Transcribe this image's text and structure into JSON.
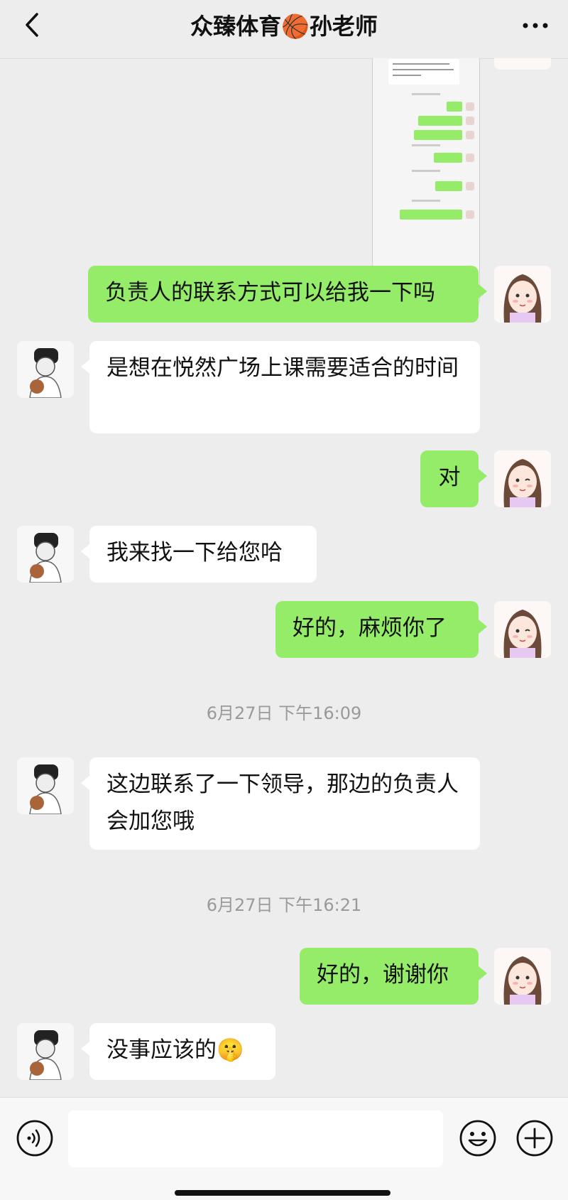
{
  "header": {
    "title": "众臻体育🏀孙老师",
    "back_icon": "chevron-left-icon",
    "more_icon": "ellipsis-icon"
  },
  "colors": {
    "background": "#ededed",
    "sent_bubble": "#95ec69",
    "received_bubble": "#ffffff",
    "timestamp": "#9a9a9a"
  },
  "messages": [
    {
      "from": "me",
      "type": "image",
      "text": "",
      "description_icon": "chat-screenshot-image"
    },
    {
      "from": "me",
      "type": "text",
      "text": "负责人的联系方式可以给我一下吗"
    },
    {
      "from": "them",
      "type": "text",
      "text": "是想在悦然广场上课需要适合的时间"
    },
    {
      "from": "me",
      "type": "text",
      "text": "对"
    },
    {
      "from": "them",
      "type": "text",
      "text": "我来找一下给您哈"
    },
    {
      "from": "me",
      "type": "text",
      "text": "好的，麻烦你了"
    },
    {
      "type": "time",
      "text": "6月27日 下午16:09"
    },
    {
      "from": "them",
      "type": "text",
      "text": "这边联系了一下领导，那边的负责人会加您哦"
    },
    {
      "type": "time",
      "text": "6月27日 下午16:21"
    },
    {
      "from": "me",
      "type": "text",
      "text": "好的，谢谢你"
    },
    {
      "from": "them",
      "type": "text",
      "text": "没事应该的",
      "emoji": "🤫"
    }
  ],
  "input_bar": {
    "placeholder": "",
    "voice_icon": "voice-icon",
    "emoji_icon": "emoji-icon",
    "plus_icon": "plus-icon"
  }
}
